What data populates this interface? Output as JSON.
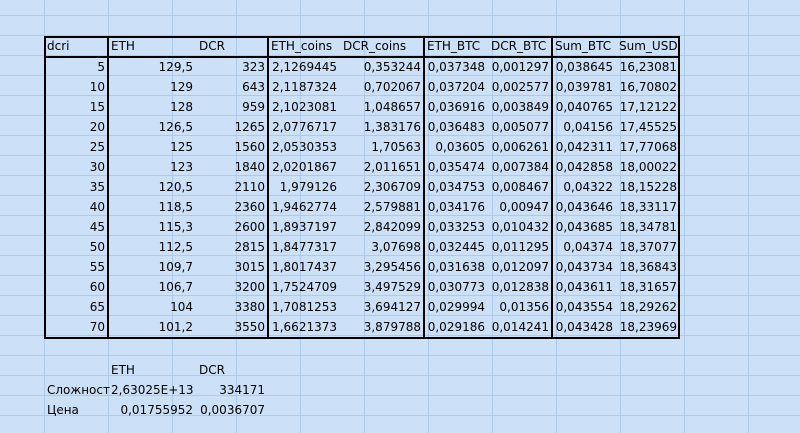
{
  "table": {
    "headers": [
      "dcri",
      "ETH",
      "DCR",
      "ETH_coins",
      "DCR_coins",
      "ETH_BTC",
      "DCR_BTC",
      "Sum_BTC",
      "Sum_USD"
    ],
    "rows": [
      [
        "5",
        "129,5",
        "323",
        "2,1269445",
        "0,353244",
        "0,037348",
        "0,001297",
        "0,038645",
        "16,23081"
      ],
      [
        "10",
        "129",
        "643",
        "2,1187324",
        "0,702067",
        "0,037204",
        "0,002577",
        "0,039781",
        "16,70802"
      ],
      [
        "15",
        "128",
        "959",
        "2,1023081",
        "1,048657",
        "0,036916",
        "0,003849",
        "0,040765",
        "17,12122"
      ],
      [
        "20",
        "126,5",
        "1265",
        "2,0776717",
        "1,383176",
        "0,036483",
        "0,005077",
        "0,04156",
        "17,45525"
      ],
      [
        "25",
        "125",
        "1560",
        "2,0530353",
        "1,70563",
        "0,03605",
        "0,006261",
        "0,042311",
        "17,77068"
      ],
      [
        "30",
        "123",
        "1840",
        "2,0201867",
        "2,011651",
        "0,035474",
        "0,007384",
        "0,042858",
        "18,00022"
      ],
      [
        "35",
        "120,5",
        "2110",
        "1,979126",
        "2,306709",
        "0,034753",
        "0,008467",
        "0,04322",
        "18,15228"
      ],
      [
        "40",
        "118,5",
        "2360",
        "1,9462774",
        "2,579881",
        "0,034176",
        "0,00947",
        "0,043646",
        "18,33117"
      ],
      [
        "45",
        "115,3",
        "2600",
        "1,8937197",
        "2,842099",
        "0,033253",
        "0,010432",
        "0,043685",
        "18,34781"
      ],
      [
        "50",
        "112,5",
        "2815",
        "1,8477317",
        "3,07698",
        "0,032445",
        "0,011295",
        "0,04374",
        "18,37077"
      ],
      [
        "55",
        "109,7",
        "3015",
        "1,8017437",
        "3,295456",
        "0,031638",
        "0,012097",
        "0,043734",
        "18,36843"
      ],
      [
        "60",
        "106,7",
        "3200",
        "1,7524709",
        "3,497529",
        "0,030773",
        "0,012838",
        "0,043611",
        "18,31657"
      ],
      [
        "65",
        "104",
        "3380",
        "1,7081253",
        "3,694127",
        "0,029994",
        "0,01356",
        "0,043554",
        "18,29262"
      ],
      [
        "70",
        "101,2",
        "3550",
        "1,6621373",
        "3,879788",
        "0,029186",
        "0,014241",
        "0,043428",
        "18,23969"
      ]
    ]
  },
  "summary": {
    "headers": [
      "ETH",
      "DCR"
    ],
    "rows": [
      {
        "label": "Сложност",
        "eth": "2,63025E+13",
        "dcr": "334171"
      },
      {
        "label": "Цена",
        "eth": "0,01755952",
        "dcr": "0,0036707"
      }
    ]
  }
}
